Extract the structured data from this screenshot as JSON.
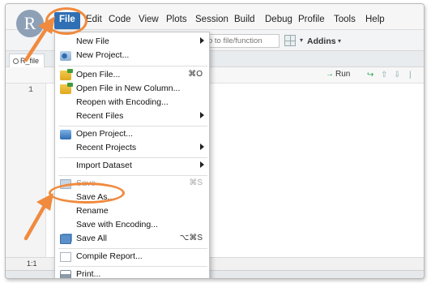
{
  "logo_letter": "R",
  "menubar": {
    "items": [
      "File",
      "Edit",
      "Code",
      "View",
      "Plots",
      "Session",
      "Build",
      "Debug",
      "Profile",
      "Tools",
      "Help"
    ]
  },
  "toolbar": {
    "goto_placeholder": "o to file/function",
    "addins_label": "Addins"
  },
  "tab": {
    "label": "R_file"
  },
  "editor_toolbar": {
    "run_label": "Run"
  },
  "editor": {
    "line_numbers": [
      "1"
    ]
  },
  "status": {
    "position": "1:1"
  },
  "file_menu": {
    "items": [
      {
        "label": "New File",
        "submenu": true
      },
      {
        "label": "New Project...",
        "icon": "new-project-icon"
      },
      {
        "label": "Open File...",
        "shortcut": "⌘O",
        "icon": "open-folder-icon"
      },
      {
        "label": "Open File in New Column...",
        "icon": "open-folder-icon"
      },
      {
        "label": "Reopen with Encoding..."
      },
      {
        "label": "Recent Files",
        "submenu": true
      },
      {
        "label": "Open Project...",
        "icon": "project-icon"
      },
      {
        "label": "Recent Projects",
        "submenu": true
      },
      {
        "label": "Import Dataset",
        "submenu": true
      },
      {
        "label": "Save",
        "shortcut": "⌘S",
        "disabled": true,
        "icon": "save-icon"
      },
      {
        "label": "Save As...",
        "highlighted_by_annotation": true
      },
      {
        "label": "Rename"
      },
      {
        "label": "Save with Encoding..."
      },
      {
        "label": "Save All",
        "shortcut": "⌥⌘S",
        "icon": "save-all-icon"
      },
      {
        "label": "Compile Report...",
        "icon": "report-icon"
      },
      {
        "label": "Print...",
        "icon": "print-icon"
      }
    ]
  },
  "annotation_color": "#f08a3e",
  "accent_color": "#2f6fb3"
}
